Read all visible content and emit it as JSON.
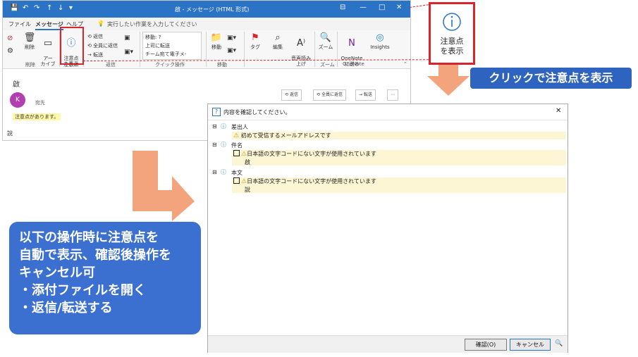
{
  "window": {
    "title": "啟 - メッセージ (HTML 形式)",
    "qat": [
      "💾",
      "↶",
      "↷",
      "↑",
      "↓",
      "▾"
    ],
    "controls": [
      "⊟",
      "—",
      "□",
      "✕"
    ]
  },
  "tabs": [
    "ファイル",
    "メッセージ",
    "ヘルプ"
  ],
  "search_placeholder": "実行したい作業を入力してください",
  "ribbon": {
    "delete_group": {
      "junk": "⊘",
      "delete": "削除",
      "archive": "アー\nカイブ",
      "label": "削除"
    },
    "info_button": "注意点\nを表示",
    "info_group_label": "注意点",
    "reply": "返信",
    "reply_all": "全員に返信",
    "forward": "転送",
    "respond_label": "返信",
    "quick_steps": [
      "移動: ?",
      "上司に転送",
      "チーム宛て電子メ-"
    ],
    "quick_label": "クイック操作",
    "move": "移動",
    "move_label": "移動",
    "tag": "タグ",
    "edit": "編集",
    "read_aloud": "音声読み\n上げ",
    "zoom": "ズーム",
    "zoom_label": "ズーム",
    "onenote": "OneNote\nに送る",
    "onenote_label": "OneNote",
    "insights": "Insights"
  },
  "message": {
    "subject": "啟",
    "avatar": "K",
    "to_label": "宛先",
    "notice": "注意点があります。",
    "body": "說",
    "reply_btn": "返信",
    "reply_all_btn": "全員に返信",
    "forward_btn": "転送",
    "more_btn": "⋯"
  },
  "callout": {
    "label": "注意点\nを表示",
    "banner": "クリックで注意点を表示"
  },
  "note": {
    "lines": [
      "以下の操作時に注意点を",
      "自動で表示、確認後操作を",
      "キャンセル可",
      "・添付ファイルを開く",
      "・返信/転送する"
    ]
  },
  "dialog": {
    "title": "内容を確認してください。",
    "close": "✕",
    "sections": [
      {
        "label": "差出人",
        "items": [
          {
            "text": "初めて受信するメールアドレスです",
            "value": ""
          }
        ]
      },
      {
        "label": "件名",
        "items": [
          {
            "text": "日本語の文字コードにない文字が使用されています",
            "value": "啟"
          }
        ]
      },
      {
        "label": "本文",
        "items": [
          {
            "text": "日本語の文字コードにない文字が使用されています",
            "value": "說"
          }
        ]
      }
    ],
    "ok": "確認(O)",
    "cancel": "キャンセル",
    "zoom_icon": "🔍"
  },
  "colors": {
    "accent": "#2b73c4",
    "red": "#d8242a",
    "orange": "#f4a47c",
    "note_blue": "#3b6fd0"
  }
}
